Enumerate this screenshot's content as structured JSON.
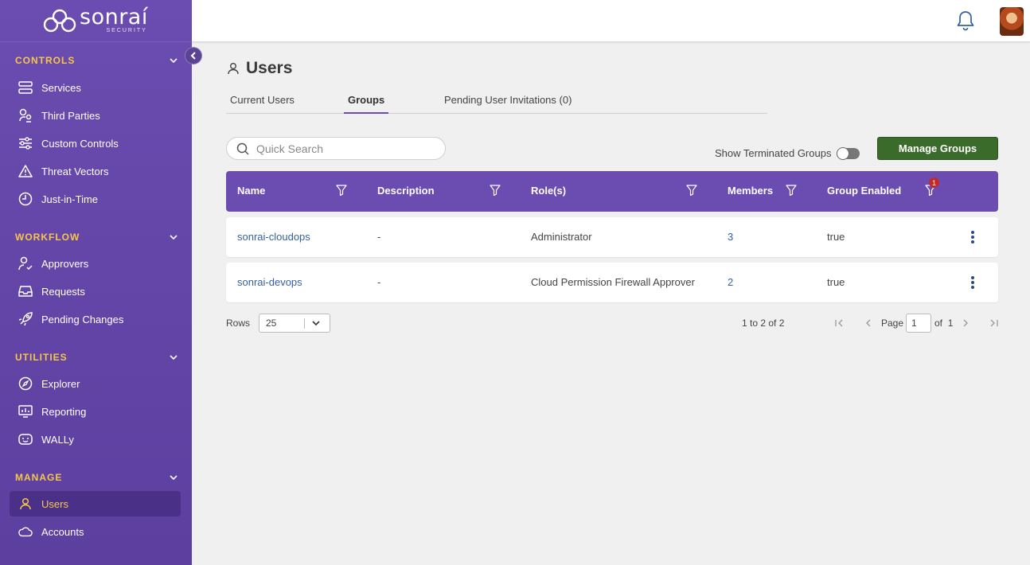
{
  "brand": {
    "name": "sonraí",
    "sub": "SECURITY"
  },
  "sidebar": {
    "sections": [
      {
        "title": "CONTROLS",
        "items": [
          {
            "label": "Services",
            "icon": "services-icon"
          },
          {
            "label": "Third Parties",
            "icon": "third-parties-icon"
          },
          {
            "label": "Custom Controls",
            "icon": "sliders-icon"
          },
          {
            "label": "Threat Vectors",
            "icon": "warning-icon"
          },
          {
            "label": "Just-in-Time",
            "icon": "clock-icon"
          }
        ]
      },
      {
        "title": "WORKFLOW",
        "items": [
          {
            "label": "Approvers",
            "icon": "user-check-icon"
          },
          {
            "label": "Requests",
            "icon": "inbox-icon"
          },
          {
            "label": "Pending Changes",
            "icon": "rocket-icon"
          }
        ]
      },
      {
        "title": "UTILITIES",
        "items": [
          {
            "label": "Explorer",
            "icon": "compass-icon"
          },
          {
            "label": "Reporting",
            "icon": "report-icon"
          },
          {
            "label": "WALLy",
            "icon": "bot-icon"
          }
        ]
      },
      {
        "title": "MANAGE",
        "items": [
          {
            "label": "Users",
            "icon": "user-icon",
            "active": true
          },
          {
            "label": "Accounts",
            "icon": "cloud-icon"
          }
        ]
      }
    ]
  },
  "page": {
    "title": "Users"
  },
  "tabs": [
    {
      "label": "Current Users"
    },
    {
      "label": "Groups",
      "active": true
    },
    {
      "label": "Pending User Invitations (0)"
    }
  ],
  "search": {
    "placeholder": "Quick Search"
  },
  "toggle": {
    "label": "Show Terminated Groups",
    "on": false
  },
  "manage_button": "Manage Groups",
  "table": {
    "columns": [
      "Name",
      "Description",
      "Role(s)",
      "Members",
      "Group Enabled"
    ],
    "active_filter_count": "1",
    "rows": [
      {
        "name": "sonrai-cloudops",
        "description": "-",
        "roles": "Administrator",
        "members": "3",
        "enabled": "true"
      },
      {
        "name": "sonrai-devops",
        "description": "-",
        "roles": "Cloud Permission Firewall Approver",
        "members": "2",
        "enabled": "true"
      }
    ]
  },
  "pagination": {
    "rows_label": "Rows",
    "rows_value": "25",
    "range": "1 to 2 of 2",
    "page_label": "Page",
    "page_value": "1",
    "of_label": "of",
    "total_pages": "1"
  },
  "colors": {
    "sidebar": "#6b4cb0",
    "accent_yellow": "#f5c74a",
    "button_green": "#3a6b2b",
    "link_blue": "#3560a0",
    "badge_red": "#c62828"
  }
}
